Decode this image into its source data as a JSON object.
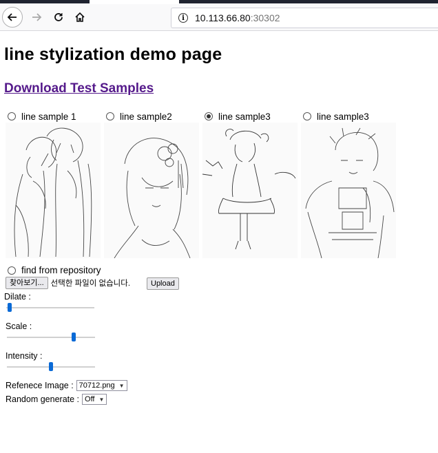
{
  "browser": {
    "url_host": "10.113.66.80",
    "url_port": ":30302"
  },
  "page": {
    "title": "line stylization demo page",
    "download_link": "Download Test Samples",
    "samples": [
      {
        "label": "line sample 1",
        "checked": false
      },
      {
        "label": "line sample2",
        "checked": false
      },
      {
        "label": "line sample3",
        "checked": true
      },
      {
        "label": "line sample3",
        "checked": false
      }
    ],
    "repository_label": "find from repository",
    "browse_button": "찾아보기...",
    "file_status": "선택한 파일이 없습니다.",
    "upload_button": "Upload",
    "dilate_label": "Dilate :",
    "scale_label": "Scale :",
    "intensity_label": "Intensity :",
    "dilate_value": 0.02,
    "scale_value": 0.77,
    "intensity_value": 0.5,
    "reference_label": "Refenece Image :",
    "reference_value": "70712.png",
    "random_label": "Random generate :",
    "random_value": "Off"
  }
}
